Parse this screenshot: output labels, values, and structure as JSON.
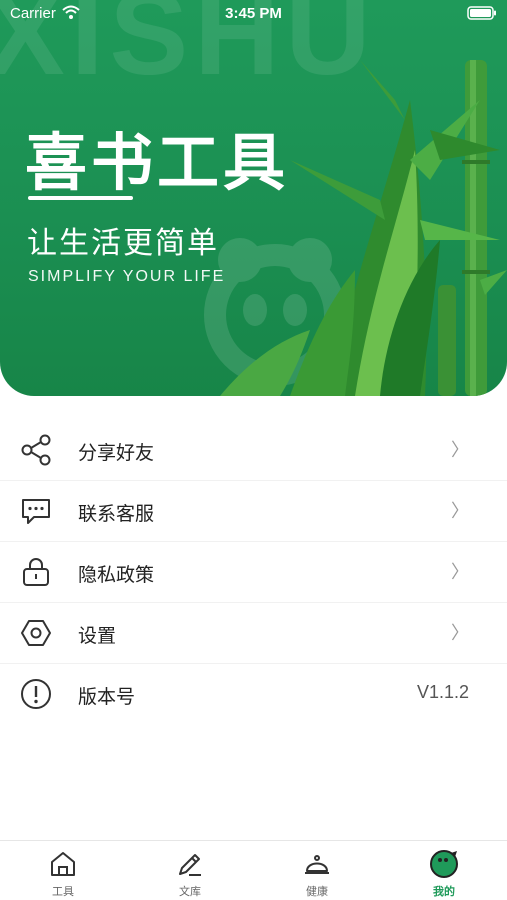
{
  "status_bar": {
    "carrier": "Carrier",
    "time": "3:45 PM"
  },
  "hero": {
    "watermark": "XISHU",
    "title": "喜书工具",
    "slogan": "让生活更简单",
    "slogan_en": "SIMPLIFY YOUR LIFE",
    "accent_color": "#1f9a5a"
  },
  "menu": {
    "items": [
      {
        "label": "分享好友",
        "icon": "share-icon",
        "trailing": "〉"
      },
      {
        "label": "联系客服",
        "icon": "chat-icon",
        "trailing": "〉"
      },
      {
        "label": "隐私政策",
        "icon": "lock-icon",
        "trailing": "〉"
      },
      {
        "label": "设置",
        "icon": "settings-icon",
        "trailing": "〉"
      },
      {
        "label": "版本号",
        "icon": "info-icon",
        "value": "V1.1.2"
      }
    ]
  },
  "tabbar": {
    "tabs": [
      {
        "label": "工具",
        "icon": "home-icon",
        "active": false
      },
      {
        "label": "文库",
        "icon": "pencil-icon",
        "active": false
      },
      {
        "label": "健康",
        "icon": "bell-icon",
        "active": false
      },
      {
        "label": "我的",
        "icon": "profile-icon",
        "active": true
      }
    ]
  }
}
